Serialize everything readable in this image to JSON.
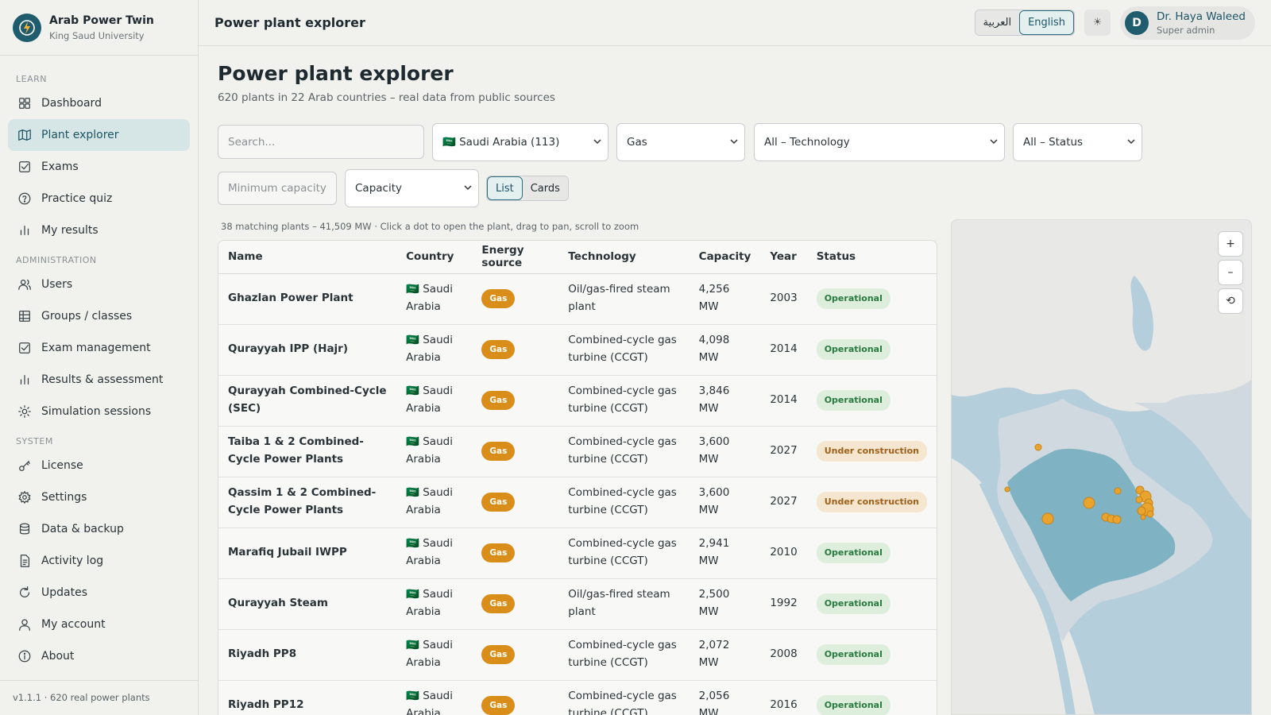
{
  "brand": {
    "title": "Arab Power Twin",
    "subtitle": "King Saud University"
  },
  "sidebar": {
    "sections": [
      {
        "label": "LEARN",
        "items": [
          {
            "label": "Dashboard",
            "icon": "dashboard-icon"
          },
          {
            "label": "Plant explorer",
            "icon": "map-icon",
            "active": true
          },
          {
            "label": "Exams",
            "icon": "checkbox-icon"
          },
          {
            "label": "Practice quiz",
            "icon": "help-circle-icon"
          },
          {
            "label": "My results",
            "icon": "bar-chart-icon"
          }
        ]
      },
      {
        "label": "ADMINISTRATION",
        "items": [
          {
            "label": "Users",
            "icon": "users-icon"
          },
          {
            "label": "Groups / classes",
            "icon": "table-icon"
          },
          {
            "label": "Exam management",
            "icon": "checkbox-icon"
          },
          {
            "label": "Results & assessment",
            "icon": "bar-chart-icon"
          },
          {
            "label": "Simulation sessions",
            "icon": "sun-icon"
          }
        ]
      },
      {
        "label": "SYSTEM",
        "items": [
          {
            "label": "License",
            "icon": "key-icon"
          },
          {
            "label": "Settings",
            "icon": "gear-icon"
          },
          {
            "label": "Data & backup",
            "icon": "database-icon"
          },
          {
            "label": "Activity log",
            "icon": "file-icon"
          },
          {
            "label": "Updates",
            "icon": "refresh-icon"
          },
          {
            "label": "My account",
            "icon": "user-icon"
          },
          {
            "label": "About",
            "icon": "info-icon"
          }
        ]
      }
    ],
    "footer": "v1.1.1 · 620 real power plants"
  },
  "header": {
    "title": "Power plant explorer",
    "lang_ar": "العربية",
    "lang_en": "English",
    "theme_glyph": "☀",
    "user": {
      "initial": "D",
      "name": "Dr. Haya Waleed",
      "role": "Super admin"
    }
  },
  "main": {
    "title": "Power plant explorer",
    "subtitle": "620 plants in 22 Arab countries – real data from public sources",
    "filters": {
      "search_placeholder": "Search...",
      "country": "🇸🇦 Saudi Arabia (113)",
      "source": "Gas",
      "technology": "All – Technology",
      "status": "All – Status",
      "min_capacity_placeholder": "Minimum capacity",
      "sort": "Capacity",
      "view_list": "List",
      "view_cards": "Cards"
    },
    "summary": "38 matching plants – 41,509 MW · Click a dot to open the plant, drag to pan, scroll to zoom",
    "table": {
      "headers": [
        "Name",
        "Country",
        "Energy source",
        "Technology",
        "Capacity",
        "Year",
        "Status"
      ],
      "rows": [
        {
          "name": "Ghazlan Power Plant",
          "country": "🇸🇦 Saudi Arabia",
          "source": "Gas",
          "tech": "Oil/gas-fired steam plant",
          "capacity": "4,256 MW",
          "year": "2003",
          "status": "Operational"
        },
        {
          "name": "Qurayyah IPP (Hajr)",
          "country": "🇸🇦 Saudi Arabia",
          "source": "Gas",
          "tech": "Combined-cycle gas turbine (CCGT)",
          "capacity": "4,098 MW",
          "year": "2014",
          "status": "Operational"
        },
        {
          "name": "Qurayyah Combined-Cycle (SEC)",
          "country": "🇸🇦 Saudi Arabia",
          "source": "Gas",
          "tech": "Combined-cycle gas turbine (CCGT)",
          "capacity": "3,846 MW",
          "year": "2014",
          "status": "Operational"
        },
        {
          "name": "Taiba 1 & 2 Combined-Cycle Power Plants",
          "country": "🇸🇦 Saudi Arabia",
          "source": "Gas",
          "tech": "Combined-cycle gas turbine (CCGT)",
          "capacity": "3,600 MW",
          "year": "2027",
          "status": "Under construction"
        },
        {
          "name": "Qassim 1 & 2 Combined-Cycle Power Plants",
          "country": "🇸🇦 Saudi Arabia",
          "source": "Gas",
          "tech": "Combined-cycle gas turbine (CCGT)",
          "capacity": "3,600 MW",
          "year": "2027",
          "status": "Under construction"
        },
        {
          "name": "Marafiq Jubail IWPP",
          "country": "🇸🇦 Saudi Arabia",
          "source": "Gas",
          "tech": "Combined-cycle gas turbine (CCGT)",
          "capacity": "2,941 MW",
          "year": "2010",
          "status": "Operational"
        },
        {
          "name": "Qurayyah Steam",
          "country": "🇸🇦 Saudi Arabia",
          "source": "Gas",
          "tech": "Oil/gas-fired steam plant",
          "capacity": "2,500 MW",
          "year": "1992",
          "status": "Operational"
        },
        {
          "name": "Riyadh PP8",
          "country": "🇸🇦 Saudi Arabia",
          "source": "Gas",
          "tech": "Combined-cycle gas turbine (CCGT)",
          "capacity": "2,072 MW",
          "year": "2008",
          "status": "Operational"
        },
        {
          "name": "Riyadh PP12",
          "country": "🇸🇦 Saudi Arabia",
          "source": "Gas",
          "tech": "Combined-cycle gas turbine (CCGT)",
          "capacity": "2,056 MW",
          "year": "2016",
          "status": "Operational"
        }
      ]
    },
    "map": {
      "zoom_in": "+",
      "zoom_out": "–",
      "reset": "⟲"
    }
  },
  "colors": {
    "accent": "#1f5d6e",
    "gas": "#d98e1a",
    "operational": "#2c7a3f",
    "under_construction": "#a0601a"
  }
}
